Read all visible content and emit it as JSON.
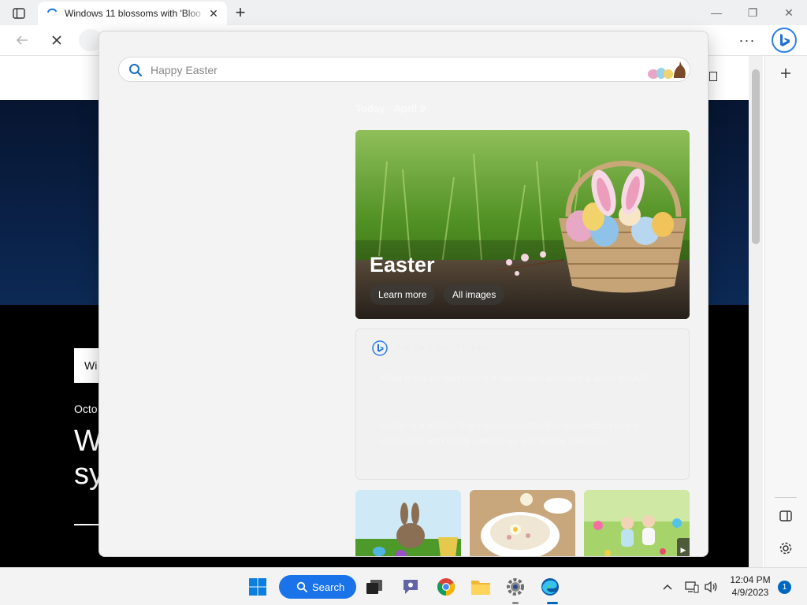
{
  "browser": {
    "tab": {
      "title": "Windows 11 blossoms with 'Bloo"
    },
    "tab_close": "✕",
    "new_tab": "+",
    "window": {
      "minimize": "—",
      "restore": "❐",
      "close": "✕"
    },
    "more": "···"
  },
  "page": {
    "box_text": "Wi",
    "date_text": "Octo",
    "headline_line1": "W",
    "headline_line2": "sy"
  },
  "flyout": {
    "search": {
      "placeholder": "Happy Easter"
    },
    "date_line": "Today  ·  April 9",
    "hero": {
      "title": "Easter",
      "learn_more": "Learn more",
      "all_images": "All images"
    },
    "chat": {
      "title": "Ask Bing about Easter",
      "paragraph1": "What is Easter and how is it celebrated around the world today?",
      "paragraph2": "Easter is a holiday that commemorates the resurrection and is celebrated with family gatherings and festive traditions."
    },
    "thumb_next": "▶"
  },
  "taskbar": {
    "search_label": "Search",
    "time": "12:04 PM",
    "date": "4/9/2023",
    "notification_count": "1",
    "tray_chevron": "^"
  },
  "colors": {
    "accent": "#1a73e8",
    "bing_blue": "#0f6cbd",
    "notification": "#0067c0"
  },
  "icons": [
    "tab-actions-icon",
    "loading-spinner-icon",
    "close-icon",
    "plus-icon",
    "back-arrow-icon",
    "stop-icon",
    "more-icon",
    "bing-copilot-icon",
    "add-icon",
    "sidebar-icon",
    "gear-icon",
    "search-icon",
    "windows-start-icon",
    "task-view-icon",
    "teams-chat-icon",
    "chrome-icon",
    "file-explorer-icon",
    "settings-icon",
    "edge-icon",
    "network-icon",
    "volume-icon"
  ]
}
